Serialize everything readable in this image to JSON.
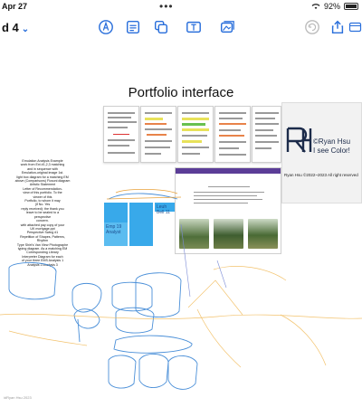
{
  "status": {
    "time": "Apr 27",
    "battery": "92%"
  },
  "toolbar": {
    "board_title": "d 4",
    "tools": [
      "pen-tool",
      "text-box-tool",
      "shapes-tool",
      "text-field-tool",
      "media-tool"
    ]
  },
  "canvas": {
    "title": "Portfolio interface",
    "logo_card": {
      "name_line1": "©Ryan Hsu",
      "name_line2": "I see Color!",
      "copyright": "Ryan Hsu ©2022~2023 All right reserved"
    },
    "left_text": [
      "Emulation Analysis Example",
      "work from Ext #1,2,3 matching",
      "and in sequence with",
      "Emulation-original image 1st.",
      "light box diagram for a matching EM",
      "above (Comparisons) Ficsoni diagram",
      "Artistic Statement",
      "Letter of Recommendation-",
      "view of this portfolio. To the",
      "viewer of this",
      "Portfolio, to whom it may",
      "(if No. Yes",
      "reply received): the thank you",
      "leave to be sealed to a",
      "perspective",
      "concern.",
      "with attached pay copy of your",
      "UK mortgage.ppt",
      "Perspective Swing #1",
      "Repetition of Shapes, Patterns,",
      "Rhythm",
      "Type Shirt's Van Vlew Photographe",
      "typing diagram. As a matching EM",
      "Corresponding Library",
      "Interpreter Diagram for each",
      "of your three EMS Analysis 1",
      "Analysis 2 Analysis 3"
    ],
    "sticky_notes": [
      "",
      "",
      "Emp 19 Analyst",
      "",
      "Leuh Bell 11"
    ],
    "watermark": "idRyan Hsu 2023"
  },
  "colors": {
    "accent": "#2a6fdb",
    "sketch": "#4a8fd8",
    "sticky": "#38a9ea",
    "highlight_yellow": "#e8e25a",
    "pencil": "#f4c95d"
  }
}
